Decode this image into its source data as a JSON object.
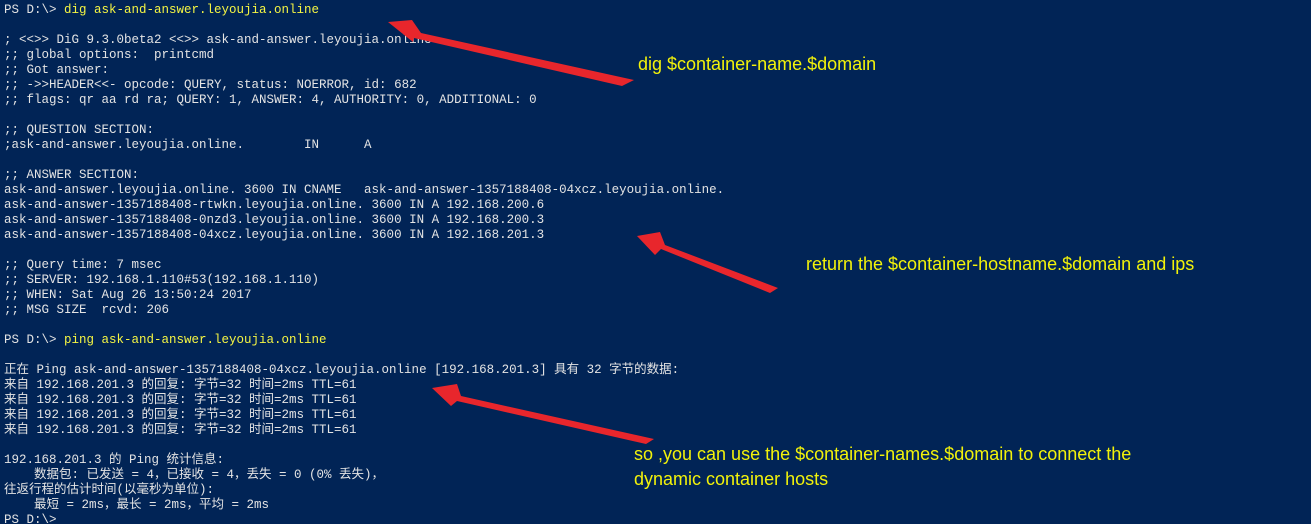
{
  "terminal": {
    "lines": [
      {
        "prompt": "PS D:\\> ",
        "command": "dig ask-and-answer.leyoujia.online"
      },
      {
        "text": ""
      },
      {
        "text": "; <<>> DiG 9.3.0beta2 <<>> ask-and-answer.leyoujia.online"
      },
      {
        "text": ";; global options:  printcmd"
      },
      {
        "text": ";; Got answer:"
      },
      {
        "text": ";; ->>HEADER<<- opcode: QUERY, status: NOERROR, id: 682"
      },
      {
        "text": ";; flags: qr aa rd ra; QUERY: 1, ANSWER: 4, AUTHORITY: 0, ADDITIONAL: 0"
      },
      {
        "text": ""
      },
      {
        "text": ";; QUESTION SECTION:"
      },
      {
        "text": ";ask-and-answer.leyoujia.online.        IN      A"
      },
      {
        "text": ""
      },
      {
        "text": ";; ANSWER SECTION:"
      },
      {
        "text": "ask-and-answer.leyoujia.online. 3600 IN CNAME   ask-and-answer-1357188408-04xcz.leyoujia.online."
      },
      {
        "text": "ask-and-answer-1357188408-rtwkn.leyoujia.online. 3600 IN A 192.168.200.6"
      },
      {
        "text": "ask-and-answer-1357188408-0nzd3.leyoujia.online. 3600 IN A 192.168.200.3"
      },
      {
        "text": "ask-and-answer-1357188408-04xcz.leyoujia.online. 3600 IN A 192.168.201.3"
      },
      {
        "text": ""
      },
      {
        "text": ";; Query time: 7 msec"
      },
      {
        "text": ";; SERVER: 192.168.1.110#53(192.168.1.110)"
      },
      {
        "text": ";; WHEN: Sat Aug 26 13:50:24 2017"
      },
      {
        "text": ";; MSG SIZE  rcvd: 206"
      },
      {
        "text": ""
      },
      {
        "prompt": "PS D:\\> ",
        "command": "ping ask-and-answer.leyoujia.online"
      },
      {
        "text": ""
      },
      {
        "text": "正在 Ping ask-and-answer-1357188408-04xcz.leyoujia.online [192.168.201.3] 具有 32 字节的数据:"
      },
      {
        "text": "来自 192.168.201.3 的回复: 字节=32 时间=2ms TTL=61"
      },
      {
        "text": "来自 192.168.201.3 的回复: 字节=32 时间=2ms TTL=61"
      },
      {
        "text": "来自 192.168.201.3 的回复: 字节=32 时间=2ms TTL=61"
      },
      {
        "text": "来自 192.168.201.3 的回复: 字节=32 时间=2ms TTL=61"
      },
      {
        "text": ""
      },
      {
        "text": "192.168.201.3 的 Ping 统计信息:"
      },
      {
        "text": "    数据包: 已发送 = 4，已接收 = 4，丢失 = 0 (0% 丢失)，"
      },
      {
        "text": "往返行程的估计时间(以毫秒为单位):"
      },
      {
        "text": "    最短 = 2ms，最长 = 2ms，平均 = 2ms"
      },
      {
        "text": "PS D:\\>"
      }
    ]
  },
  "annotations": {
    "dig_note": "dig $container-name.$domain",
    "return_note": "return the $container-hostname.$domain and ips",
    "connect_note_line1": "so ,you can use the $container-names.$domain  to connect the",
    "connect_note_line2": "dynamic container hosts"
  },
  "colors": {
    "background": "#012456",
    "text": "#e4e4e4",
    "command": "#f5f543",
    "annotation": "#f2f20a",
    "arrow": "#e8262c"
  }
}
